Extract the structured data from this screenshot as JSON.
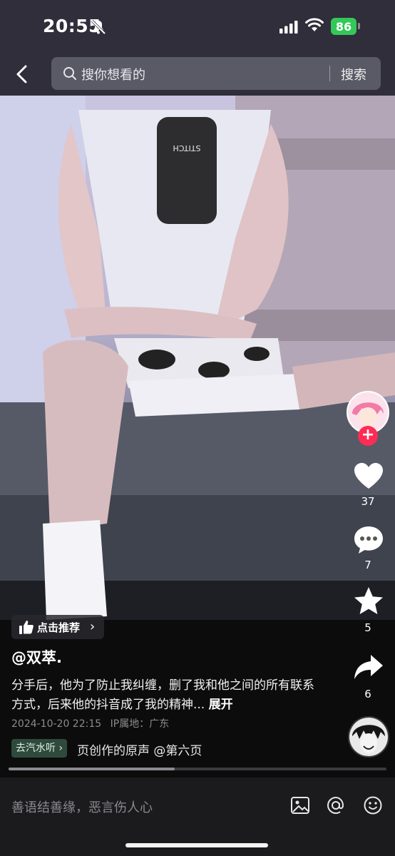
{
  "status_bar": {
    "time": "20:55",
    "battery": "86"
  },
  "search": {
    "placeholder": "搜你想看的",
    "button_label": "搜索"
  },
  "video": {
    "phone_case_text": "STITCH"
  },
  "actions": {
    "likes": "37",
    "comments": "7",
    "favorites": "5",
    "shares": "6"
  },
  "recommend": {
    "label": "点击推荐"
  },
  "post": {
    "author": "@双萃.",
    "description": "分手后，他为了防止我纠缠，删了我和他之间的所有联系方式，后来他的抖音成了我的精神...",
    "expand_label": "展开",
    "date": "2024-10-20 22:15",
    "ip_label": "IP属地：广东",
    "music_tag": "去汽水听",
    "music_title": "页创作的原声    @第六页"
  },
  "progress": {
    "fraction": 0.44
  },
  "comment_bar": {
    "placeholder": "善语结善缘，恶言伤人心"
  },
  "colors": {
    "like_red": "#fe2c55",
    "music_tag_bg": "#2f4a3d"
  }
}
